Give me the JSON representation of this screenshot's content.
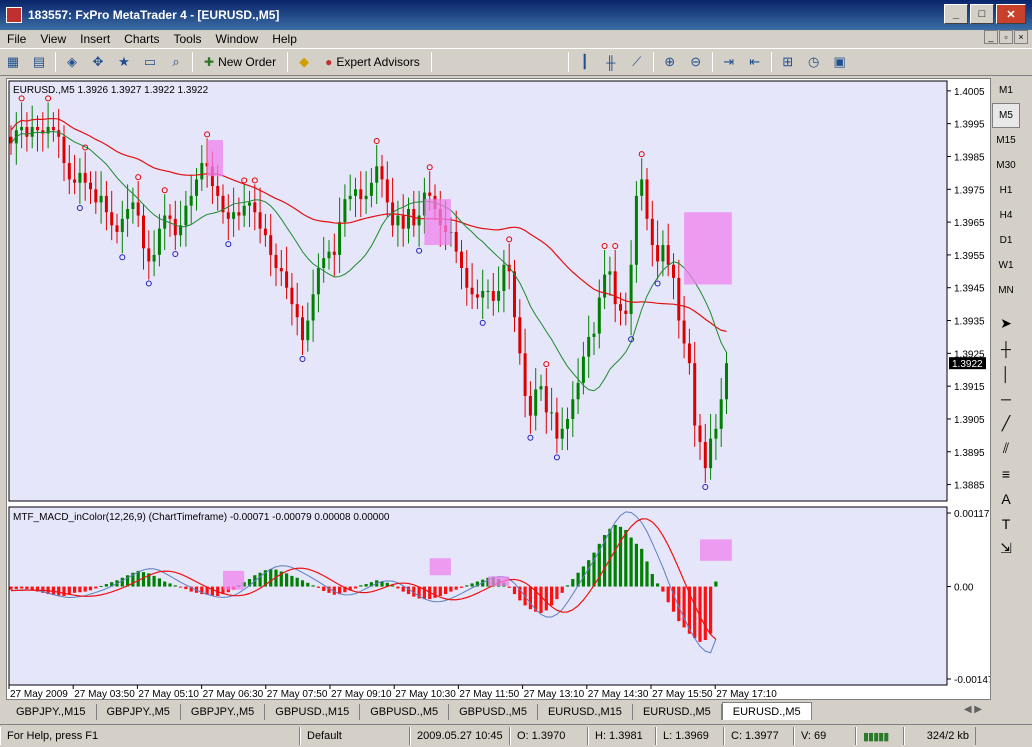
{
  "window": {
    "title": "183557: FxPro MetaTrader 4 - [EURUSD.,M5]"
  },
  "menu": [
    "File",
    "View",
    "Insert",
    "Charts",
    "Tools",
    "Window",
    "Help"
  ],
  "toolbar": {
    "new_order": "New Order",
    "expert_advisors": "Expert Advisors"
  },
  "timeframes": [
    "M1",
    "M5",
    "M15",
    "M30",
    "H1",
    "H4",
    "D1",
    "W1",
    "MN"
  ],
  "active_timeframe": "M5",
  "chart": {
    "header": "EURUSD.,M5  1.3926 1.3927 1.3922 1.3922",
    "price_ticks": [
      "1.4005",
      "1.3995",
      "1.3985",
      "1.3975",
      "1.3965",
      "1.3955",
      "1.3945",
      "1.3935",
      "1.3925",
      "1.3915",
      "1.3905",
      "1.3895",
      "1.3885"
    ],
    "current_price": "1.3922",
    "indicator_header": "MTF_MACD_inColor(12,26,9) (ChartTimeframe) -0.00071 -0.00079 0.00008 0.00000",
    "indicator_ticks": [
      "0.00117",
      "0.00",
      "-0.00147"
    ],
    "time_labels": [
      "27 May 2009",
      "27 May 03:50",
      "27 May 05:10",
      "27 May 06:30",
      "27 May 07:50",
      "27 May 09:10",
      "27 May 10:30",
      "27 May 11:50",
      "27 May 13:10",
      "27 May 14:30",
      "27 May 15:50",
      "27 May 17:10"
    ],
    "colors": {
      "bg": "#e6e6fa",
      "bull": "#008000",
      "bear": "#dd0000",
      "ma_slow": "#e01010",
      "ma_fast": "#1a8a2a",
      "highlight": "#ee82ee",
      "macd_line": "#ee1111",
      "signal_line": "#5b7fbf"
    }
  },
  "chart_data": {
    "type": "candlestick",
    "close": [
      1.3989,
      1.3993,
      1.3994,
      1.3991,
      1.3994,
      1.3993,
      1.3992,
      1.3994,
      1.3993,
      1.3991,
      1.3983,
      1.3978,
      1.3977,
      1.398,
      1.3977,
      1.3975,
      1.3971,
      1.3973,
      1.3968,
      1.3964,
      1.3962,
      1.3966,
      1.3969,
      1.3971,
      1.3967,
      1.3957,
      1.3953,
      1.3955,
      1.3963,
      1.3967,
      1.3966,
      1.3961,
      1.3964,
      1.397,
      1.3973,
      1.3978,
      1.3983,
      1.3982,
      1.3976,
      1.3973,
      1.3968,
      1.3966,
      1.3968,
      1.3967,
      1.397,
      1.3971,
      1.3968,
      1.3963,
      1.3961,
      1.3955,
      1.3951,
      1.395,
      1.3945,
      1.394,
      1.3936,
      1.3929,
      1.3935,
      1.3943,
      1.3951,
      1.3954,
      1.3956,
      1.3955,
      1.3965,
      1.3972,
      1.3973,
      1.3975,
      1.3972,
      1.3973,
      1.3977,
      1.3982,
      1.3978,
      1.3971,
      1.3964,
      1.3967,
      1.3963,
      1.3969,
      1.3964,
      1.3967,
      1.3974,
      1.3973,
      1.3969,
      1.3964,
      1.3962,
      1.3962,
      1.3956,
      1.3951,
      1.3945,
      1.3943,
      1.3942,
      1.3944,
      1.3944,
      1.3941,
      1.3944,
      1.3952,
      1.395,
      1.3936,
      1.3925,
      1.3912,
      1.3906,
      1.3914,
      1.3915,
      1.3907,
      1.3907,
      1.3899,
      1.3902,
      1.3905,
      1.3911,
      1.3916,
      1.3924,
      1.393,
      1.3931,
      1.3942,
      1.3949,
      1.395,
      1.394,
      1.3938,
      1.3937,
      1.3952,
      1.3973,
      1.3978,
      1.3966,
      1.3958,
      1.3953,
      1.3958,
      1.3952,
      1.3948,
      1.3935,
      1.3928,
      1.3922,
      1.3903,
      1.3898,
      1.389,
      1.3899,
      1.3902,
      1.3911,
      1.3922
    ],
    "macd_hist": [
      -5e-05,
      -4e-05,
      -3e-05,
      -4e-05,
      -6e-05,
      -8e-05,
      -0.0001,
      -0.00012,
      -0.00013,
      -0.00014,
      -0.00015,
      -0.00013,
      -0.0001,
      -9e-05,
      -8e-05,
      -6e-05,
      -3e-05,
      1e-05,
      4e-05,
      7e-05,
      0.0001,
      0.00014,
      0.00018,
      0.00022,
      0.00025,
      0.00023,
      0.00021,
      0.00017,
      0.00013,
      8e-05,
      5e-05,
      2e-05,
      -1e-05,
      -4e-05,
      -8e-05,
      -0.0001,
      -0.00012,
      -0.00013,
      -0.00014,
      -0.00015,
      -0.00012,
      -9e-05,
      -5e-05,
      2e-05,
      7e-05,
      0.00012,
      0.00018,
      0.00022,
      0.00026,
      0.00028,
      0.00027,
      0.00024,
      0.00021,
      0.00017,
      0.00014,
      0.0001,
      6e-05,
      2e-05,
      -2e-05,
      -7e-05,
      -0.0001,
      -0.00013,
      -0.00012,
      -9e-05,
      -6e-05,
      -3e-05,
      2e-05,
      4e-05,
      7e-05,
      0.0001,
      8e-05,
      6e-05,
      2e-05,
      -3e-05,
      -8e-05,
      -0.00012,
      -0.00016,
      -0.00019,
      -0.0002,
      -0.0002,
      -0.00018,
      -0.00015,
      -0.00012,
      -8e-05,
      -5e-05,
      -2e-05,
      2e-05,
      5e-05,
      8e-05,
      0.00011,
      0.00014,
      0.00016,
      0.00012,
      6e-05,
      -2e-05,
      -0.00012,
      -0.00022,
      -0.0003,
      -0.00036,
      -0.0004,
      -0.00042,
      -0.00038,
      -0.0003,
      -0.0002,
      -0.0001,
      2e-05,
      0.00012,
      0.00022,
      0.00032,
      0.00042,
      0.00054,
      0.00068,
      0.00082,
      0.00092,
      0.00098,
      0.00095,
      0.0009,
      0.00078,
      0.00068,
      0.0006,
      0.0004,
      0.0002,
      5e-05,
      -8e-05,
      -0.00025,
      -0.0004,
      -0.00055,
      -0.00065,
      -0.00075,
      -0.00082,
      -0.00088,
      -0.00085,
      -0.00075,
      8e-05
    ]
  },
  "tabs": [
    "GBPJPY.,M15",
    "GBPJPY.,M5",
    "GBPJPY.,M5",
    "GBPUSD.,M15",
    "GBPUSD.,M5",
    "GBPUSD.,M5",
    "EURUSD.,M15",
    "EURUSD.,M5",
    "EURUSD.,M5"
  ],
  "status": {
    "help": "For Help, press F1",
    "profile": "Default",
    "datetime": "2009.05.27 10:45",
    "open": "O: 1.3970",
    "high": "H: 1.3981",
    "low": "L: 1.3969",
    "close": "C: 1.3977",
    "volume": "V: 69",
    "traffic": "324/2 kb"
  }
}
